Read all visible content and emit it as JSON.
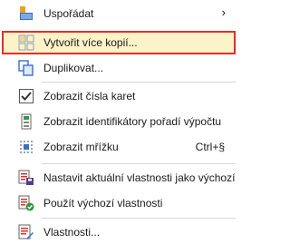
{
  "menu": {
    "items": [
      {
        "label": "Uspořádat",
        "icon": "arrange-icon",
        "has_submenu": true
      },
      {
        "label": "Vytvořit více kopií...",
        "icon": "grid-copies-icon",
        "highlighted": true
      },
      {
        "label": "Duplikovat...",
        "icon": "duplicate-icon"
      },
      {
        "label": "Zobrazit čísla karet",
        "icon": "checkbox-checked-icon",
        "checked": true
      },
      {
        "label": "Zobrazit identifikátory pořadí výpočtu",
        "icon": "calculation-order-icon"
      },
      {
        "label": "Zobrazit mřížku",
        "icon": "grid-dots-icon",
        "shortcut": "Ctrl+§"
      },
      {
        "label": "Nastavit aktuální vlastnosti jako výchozí",
        "icon": "save-default-properties-icon"
      },
      {
        "label": "Použít výchozí vlastnosti",
        "icon": "apply-default-properties-icon"
      },
      {
        "label": "Vlastnosti...",
        "icon": "properties-icon"
      }
    ],
    "submenu_glyph": "›"
  },
  "colors": {
    "highlight_fill": "#fdf3c8",
    "highlight_border": "#e0302b",
    "separator": "#d9d9d9",
    "icon_green": "#2e9a3e",
    "icon_blue": "#3a6fc4",
    "icon_orange": "#f0a020"
  }
}
